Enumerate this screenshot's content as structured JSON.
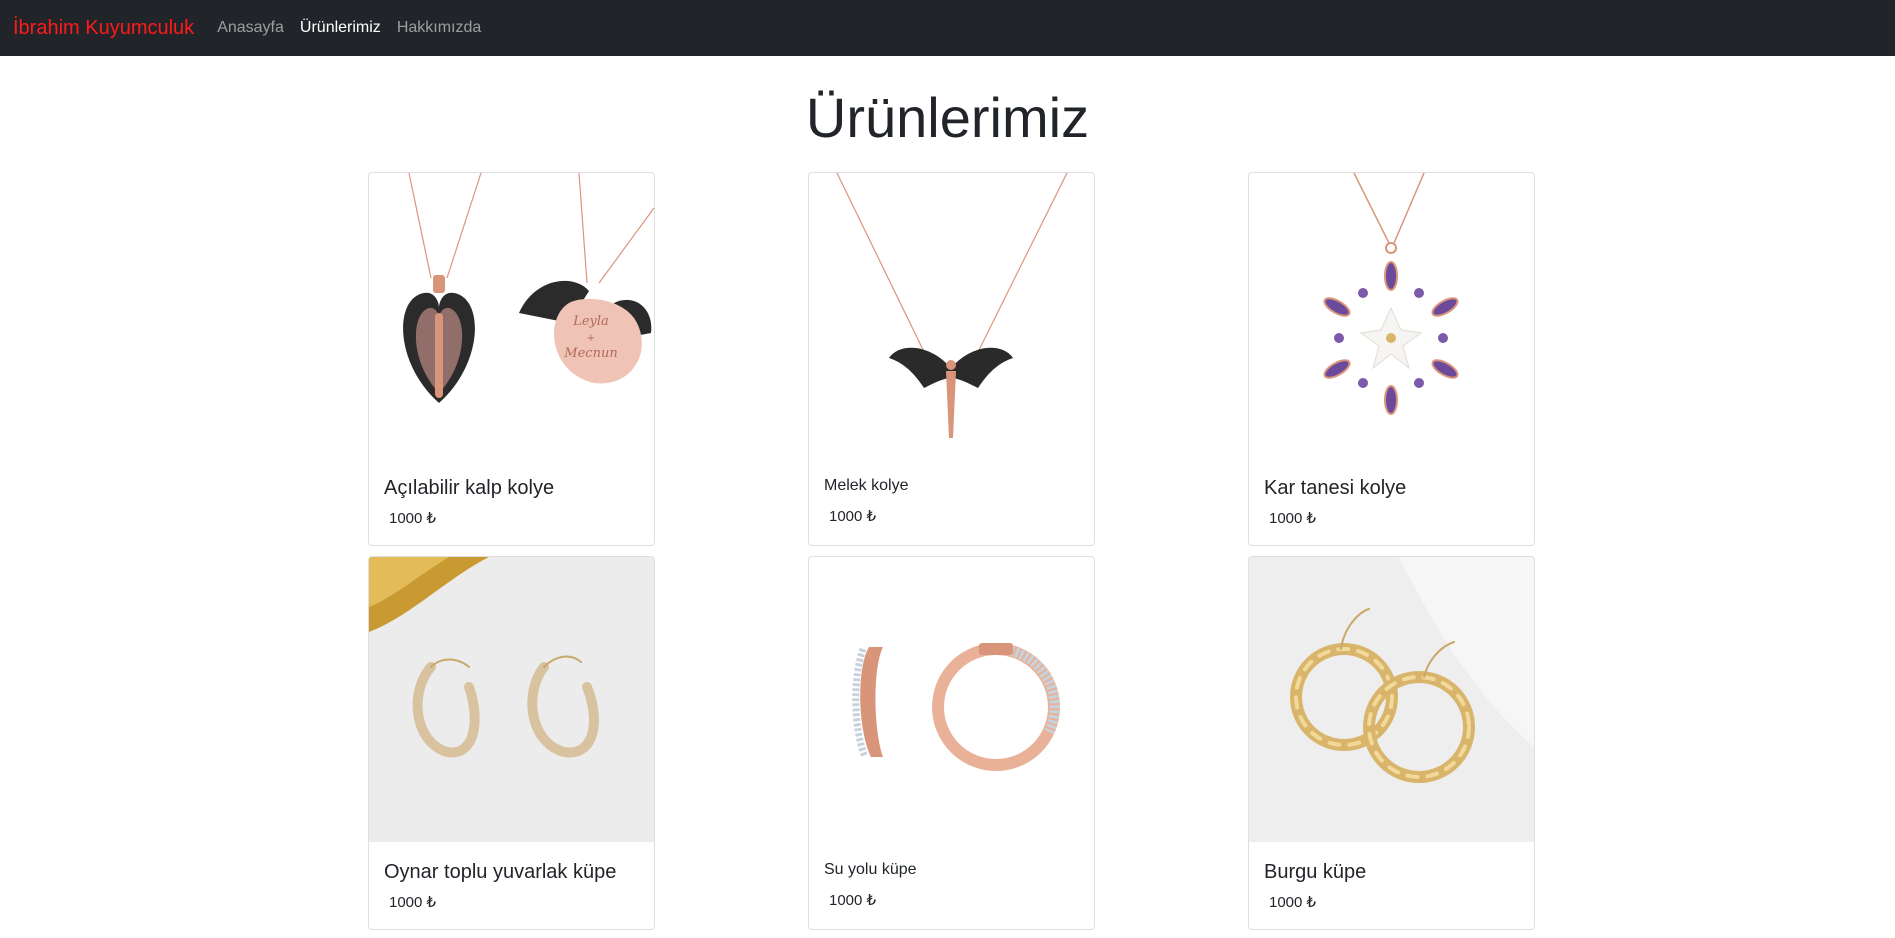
{
  "nav": {
    "brand": "İbrahim Kuyumculuk",
    "links": [
      "Anasayfa",
      "Ürünlerimiz",
      "Hakkımızda"
    ],
    "active": "Ürünlerimiz"
  },
  "page": {
    "title": "Ürünlerimiz"
  },
  "products": [
    {
      "name": "Açılabilir kalp kolye",
      "price": "1000 ₺",
      "engraving": [
        "Leyla",
        "+",
        "Mecnun"
      ]
    },
    {
      "name": "Melek kolye",
      "price": "1000 ₺"
    },
    {
      "name": "Kar tanesi kolye",
      "price": "1000 ₺"
    },
    {
      "name": "Oynar toplu yuvarlak küpe",
      "price": "1000 ₺"
    },
    {
      "name": "Su yolu küpe",
      "price": "1000 ₺"
    },
    {
      "name": "Burgu küpe",
      "price": "1000 ₺"
    }
  ],
  "colors": {
    "navbar": "#212529",
    "brand": "#ff1a1a",
    "rose_gold": "#d9957a",
    "gold": "#d8b56a"
  }
}
